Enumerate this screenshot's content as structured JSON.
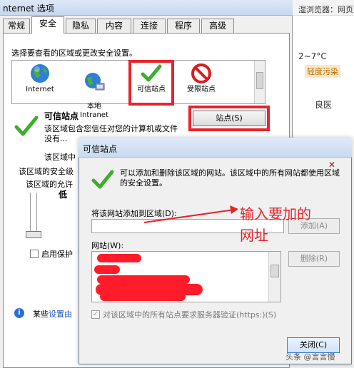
{
  "window": {
    "title": "nternet 选项",
    "close": "✕"
  },
  "tabs": [
    {
      "label": "常规"
    },
    {
      "label": "安全"
    },
    {
      "label": "隐私"
    },
    {
      "label": "内容"
    },
    {
      "label": "连接"
    },
    {
      "label": "程序"
    },
    {
      "label": "高级"
    }
  ],
  "security": {
    "instruction": "选择要查看的区域或更改安全设置。",
    "zones": [
      {
        "label": "Internet"
      },
      {
        "label": "本地\nIntranet"
      },
      {
        "label": "可信站点"
      },
      {
        "label": "受限站点"
      }
    ],
    "zone_title": "可信站点",
    "zone_desc": "该区域包含您信任对您的计算机或文件没有...",
    "zone_desc2": "该区域中",
    "sites_button": "站点(S)",
    "level_label": "该区域的安全级",
    "level_label2": "该区域的允许",
    "level_value": "低",
    "protect_label": "启用保护",
    "info_prefix": "某些",
    "info_link": "设置由"
  },
  "browser_strip": {
    "title": "湿浏览器：网页",
    "temp": "2~7°C",
    "pm": "轻度污染",
    "grade": "良医"
  },
  "dialog": {
    "title": "可信站点",
    "close": "✕",
    "desc": "可以添加和删除该区域的网站。该区域中的所有网站都使用区域的安全设置。",
    "add_label": "将该网站添加到区域(D):",
    "add_value": "",
    "add_button": "添加(A)",
    "sites_label": "网站(W):",
    "remove_button": "删除(R)",
    "https_label": "对该区域中的所有站点要求服务器验证(https:)(S)",
    "https_checked": "✓",
    "close_button": "关闭(C)"
  },
  "annotation": {
    "line1": "输入要加的",
    "line2": "网址"
  },
  "watermark": "头条 @言言慢",
  "colors": {
    "annotation_red": "#e8232a",
    "redaction": "#ff1c2a",
    "link": "#1a55c0"
  }
}
